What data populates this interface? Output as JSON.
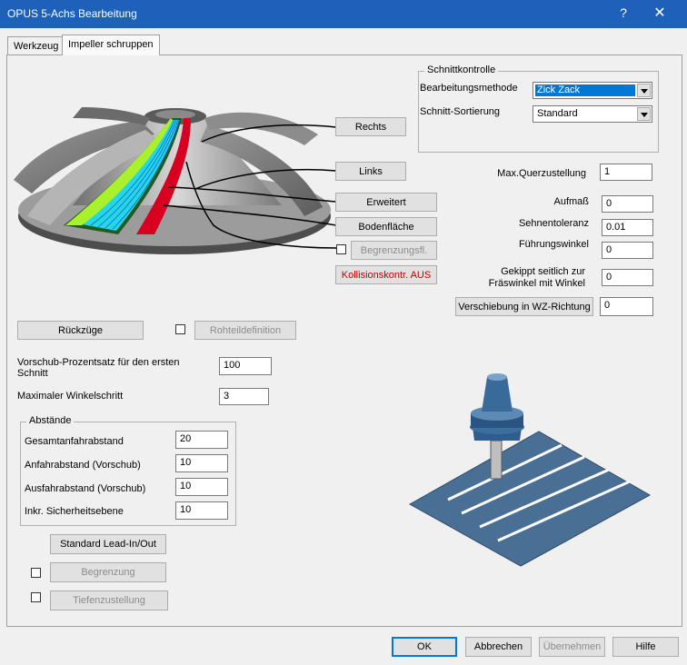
{
  "window": {
    "title": "OPUS 5-Achs Bearbeitung",
    "help": "?",
    "close": "✕"
  },
  "tabs": [
    {
      "label": "Werkzeug"
    },
    {
      "label": "Impeller schruppen"
    }
  ],
  "schnittkontrolle": {
    "title": "Schnittkontrolle",
    "methode_label": "Bearbeitungsmethode",
    "methode_value": "Zick Zack",
    "sortierung_label": "Schnitt-Sortierung",
    "sortierung_value": "Standard"
  },
  "impeller_buttons": {
    "rechts": "Rechts",
    "links": "Links",
    "erweitert": "Erweitert",
    "bodenflaeche": "Bodenfläche",
    "begrenzungsfl": "Begrenzungsfl.",
    "kollision": "Kollisionskontr. AUS"
  },
  "params": {
    "max_querzustellung_label": "Max.Querzustellung",
    "max_querzustellung": "1",
    "aufmass_label": "Aufmaß",
    "aufmass": "0",
    "sehnentoleranz_label": "Sehnentoleranz",
    "sehnentoleranz": "0.01",
    "fuehrungswinkel_label": "Führungswinkel",
    "fuehrungswinkel": "0",
    "gekippt_label_1": "Gekippt seitlich zur",
    "gekippt_label_2": "Fräswinkel mit Winkel",
    "gekippt": "0",
    "verschiebung_label": "Verschiebung in WZ-Richtung",
    "verschiebung": "0"
  },
  "left": {
    "rueckzuege": "Rückzüge",
    "rohteil": "Rohteildefinition",
    "vorschub_label": "Vorschub-Prozentsatz für den ersten Schnitt",
    "vorschub": "100",
    "winkel_label": "Maximaler Winkelschritt",
    "winkel": "3"
  },
  "abstaende": {
    "title": "Abstände",
    "gesamt_label": "Gesamtanfahrabstand",
    "gesamt": "20",
    "anfahr_label": "Anfahrabstand (Vorschub)",
    "anfahr": "10",
    "ausfahr_label": "Ausfahrabstand (Vorschub)",
    "ausfahr": "10",
    "inkr_label": "Inkr. Sicherheitsebene",
    "inkr": "10"
  },
  "bottom_left": {
    "lead": "Standard Lead-In/Out",
    "begrenzung": "Begrenzung",
    "tiefen": "Tiefenzustellung"
  },
  "footer": {
    "ok": "OK",
    "abbrechen": "Abbrechen",
    "uebernehmen": "Übernehmen",
    "hilfe": "Hilfe"
  },
  "colors": {
    "titlebar": "#1d61ba",
    "kollision_text": "#c00000",
    "tool_blue": "#2f5e8e",
    "plate": "#4a6f95"
  }
}
